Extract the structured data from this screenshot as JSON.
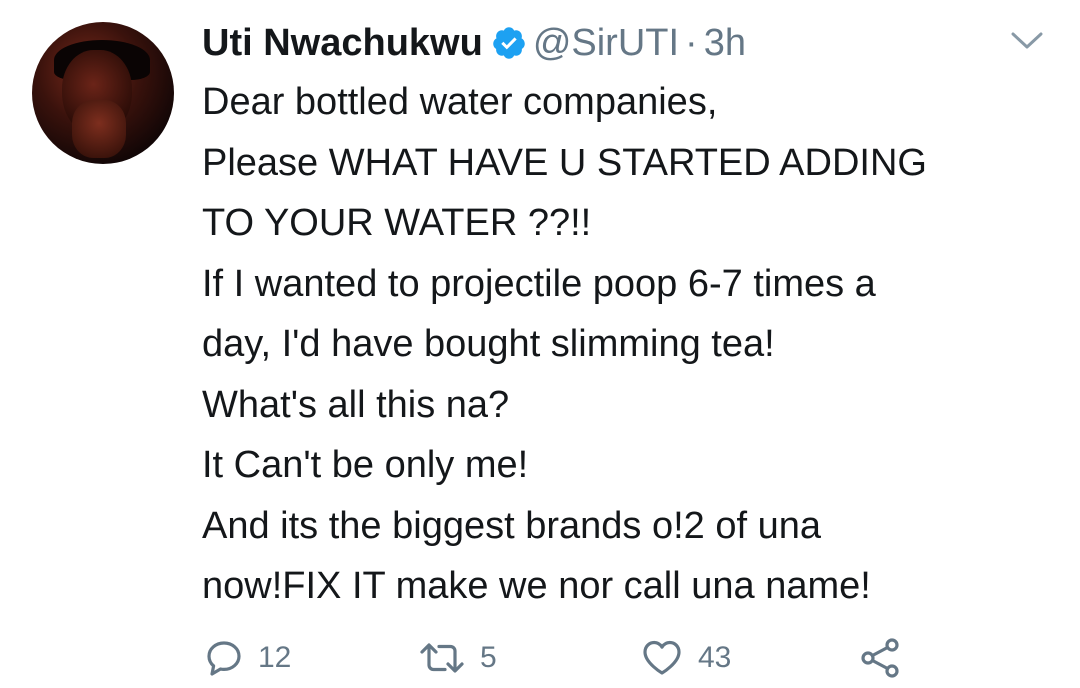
{
  "tweet": {
    "author_name": "Uti Nwachukwu",
    "handle": "@SirUTI",
    "separator": "·",
    "time": "3h",
    "lines": [
      "Dear bottled water companies,",
      "Please WHAT HAVE U STARTED ADDING",
      "TO YOUR WATER ??!!",
      "If I wanted to projectile poop 6-7 times a",
      "day, I'd have bought slimming tea!",
      "What's all this na?",
      "It Can't be only me!",
      "And its the biggest brands o!2 of una",
      "now!FIX IT make we nor call una name!"
    ],
    "counts": {
      "replies": "12",
      "retweets": "5",
      "likes": "43"
    }
  },
  "colors": {
    "text": "#14171a",
    "secondary": "#657786",
    "verified": "#1da1f2"
  },
  "icons": [
    "verified-badge-icon",
    "chevron-down-icon",
    "reply-icon",
    "retweet-icon",
    "like-icon",
    "share-icon"
  ]
}
